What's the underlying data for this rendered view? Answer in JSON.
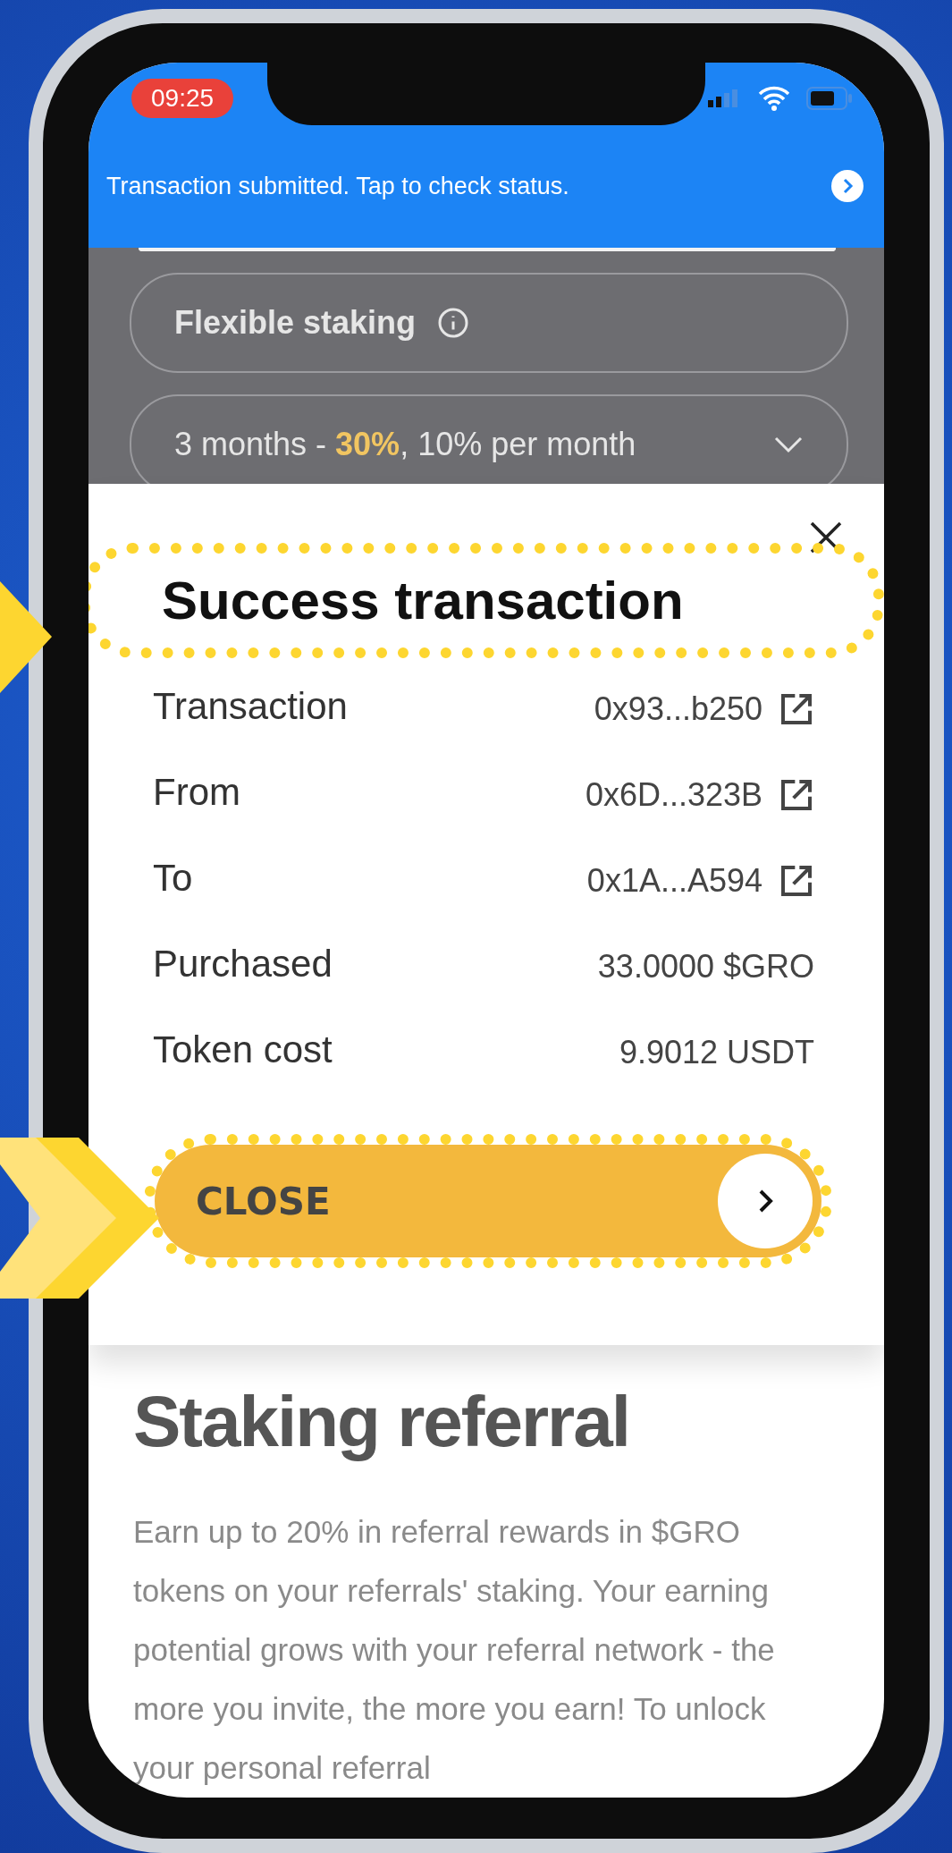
{
  "status_bar": {
    "time": "09:25"
  },
  "banner": {
    "text": "Transaction submitted. Tap to check status."
  },
  "staking": {
    "type_label": "Flexible staking",
    "period": "3 months - **30%**, 10% per month"
  },
  "modal": {
    "title": "Success transaction",
    "rows": [
      {
        "label": "Transaction",
        "value": "0x93...b250",
        "kind": "link"
      },
      {
        "label": "From",
        "value": "0x6D...323B",
        "kind": "link"
      },
      {
        "label": "To",
        "value": "0x1A...A594",
        "kind": "link"
      },
      {
        "label": "Purchased",
        "value": "33.0000 $GRO",
        "kind": "plain"
      },
      {
        "label": "Token cost",
        "value": "9.9012 USDT",
        "kind": "plain"
      }
    ],
    "button": "CLOSE"
  },
  "referral": {
    "title": "Staking referral",
    "text": "Earn up to 20% in referral rewards in $GRO tokens on your referrals' staking. Your earning potential grows with your referral network - the more you invite, the more you earn! To unlock your personal referral"
  }
}
